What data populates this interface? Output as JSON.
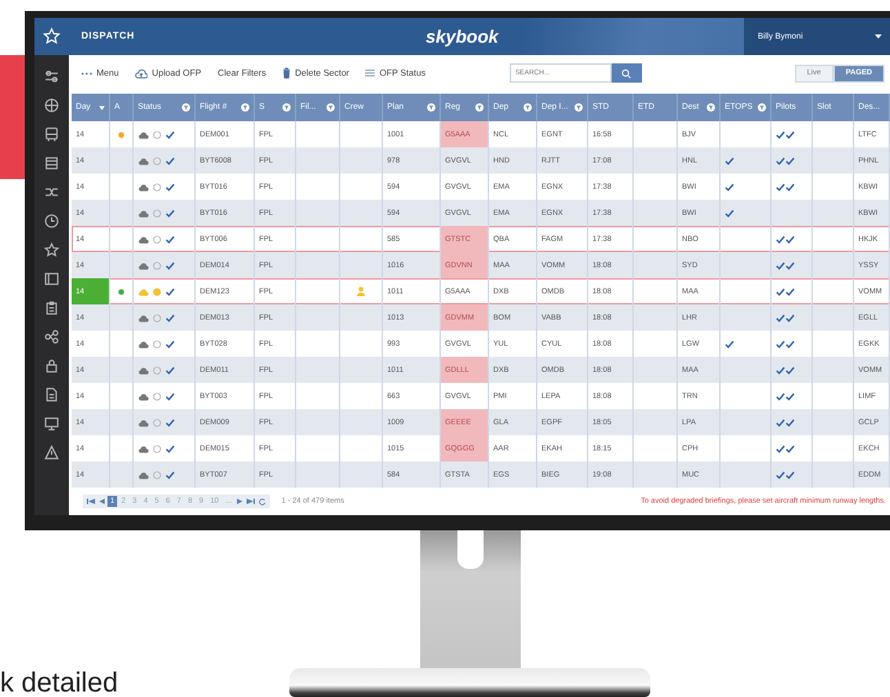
{
  "header": {
    "title": "DISPATCH",
    "brand": "skybook",
    "user": "Billy Bymoni"
  },
  "toolbar": {
    "items": [
      {
        "label": "Menu"
      },
      {
        "label": "Upload OFP"
      },
      {
        "label": "Clear Filters"
      },
      {
        "label": "Delete Sector"
      },
      {
        "label": "OFP Status"
      }
    ],
    "search": {
      "placeholder": "SEARCH..."
    },
    "view_toggle": [
      {
        "label": "Live",
        "selected": false
      },
      {
        "label": "PAGED",
        "selected": true
      }
    ]
  },
  "table": {
    "columns": [
      {
        "label": "Day",
        "kind": "sort"
      },
      {
        "label": "A",
        "kind": "plain"
      },
      {
        "label": "Status",
        "kind": "filter"
      },
      {
        "label": "Flight #",
        "kind": "filter"
      },
      {
        "label": "S",
        "kind": "filter"
      },
      {
        "label": "Fil...",
        "kind": "filter"
      },
      {
        "label": "Crew",
        "kind": "plain"
      },
      {
        "label": "Plan",
        "kind": "filter"
      },
      {
        "label": "Reg",
        "kind": "filter"
      },
      {
        "label": "Dep",
        "kind": "filter"
      },
      {
        "label": "Dep I...",
        "kind": "filter"
      },
      {
        "label": "STD",
        "kind": "plain"
      },
      {
        "label": "ETD",
        "kind": "plain"
      },
      {
        "label": "Dest",
        "kind": "filter"
      },
      {
        "label": "ETOPS",
        "kind": "filter"
      },
      {
        "label": "Pilots",
        "kind": "plain"
      },
      {
        "label": "Slot",
        "kind": "plain"
      },
      {
        "label": "Des...",
        "kind": "plain"
      }
    ],
    "rows": [
      {
        "day": "14",
        "day_highlight": false,
        "color": "#f5a623",
        "status_warning": false,
        "flight": "DEM001",
        "s": "FPL",
        "crew_alert": false,
        "plan": "1001",
        "reg": "G5AAA",
        "reg_alert": true,
        "dep": "NCL",
        "dep_icao": "EGNT",
        "std": "16:58",
        "dest": "BJV",
        "etops": false,
        "pilots": true,
        "dest_icao": "LTFC",
        "flagged": false
      },
      {
        "day": "14",
        "day_highlight": false,
        "status_warning": false,
        "flight": "BYT6008",
        "s": "FPL",
        "crew_alert": false,
        "plan": "978",
        "reg": "GVGVL",
        "reg_alert": false,
        "dep": "HND",
        "dep_icao": "RJTT",
        "std": "17:08",
        "dest": "HNL",
        "etops": true,
        "pilots": true,
        "dest_icao": "PHNL",
        "flagged": false
      },
      {
        "day": "14",
        "day_highlight": false,
        "status_warning": false,
        "flight": "BYT016",
        "s": "FPL",
        "crew_alert": false,
        "plan": "594",
        "reg": "GVGVL",
        "reg_alert": false,
        "dep": "EMA",
        "dep_icao": "EGNX",
        "std": "17:38",
        "dest": "BWI",
        "etops": true,
        "pilots": true,
        "dest_icao": "KBWI",
        "flagged": false
      },
      {
        "day": "14",
        "day_highlight": false,
        "status_warning": false,
        "flight": "BYT016",
        "s": "FPL",
        "crew_alert": false,
        "plan": "594",
        "reg": "GVGVL",
        "reg_alert": false,
        "dep": "EMA",
        "dep_icao": "EGNX",
        "std": "17:38",
        "dest": "BWI",
        "etops": true,
        "pilots": false,
        "dest_icao": "KBWI",
        "flagged": false
      },
      {
        "day": "14",
        "day_highlight": false,
        "status_warning": false,
        "flight": "BYT006",
        "s": "FPL",
        "crew_alert": false,
        "plan": "585",
        "reg": "GTSTC",
        "reg_alert": true,
        "dep": "QBA",
        "dep_icao": "FAGM",
        "std": "17:38",
        "dest": "NBO",
        "etops": false,
        "pilots": true,
        "dest_icao": "HKJK",
        "flagged": true
      },
      {
        "day": "14",
        "day_highlight": false,
        "status_warning": false,
        "flight": "DEM014",
        "s": "FPL",
        "crew_alert": false,
        "plan": "1016",
        "reg": "GDVNN",
        "reg_alert": true,
        "dep": "MAA",
        "dep_icao": "VOMM",
        "std": "18:08",
        "dest": "SYD",
        "etops": false,
        "pilots": true,
        "dest_icao": "YSSY",
        "flagged": false
      },
      {
        "day": "14",
        "day_highlight": true,
        "color": "#3cb043",
        "status_warning": true,
        "flight": "DEM123",
        "s": "FPL",
        "crew_alert": true,
        "plan": "1011",
        "reg": "G5AAA",
        "reg_alert": false,
        "dep": "DXB",
        "dep_icao": "OMDB",
        "std": "18:08",
        "dest": "MAA",
        "etops": false,
        "pilots": true,
        "dest_icao": "VOMM",
        "flagged": true
      },
      {
        "day": "14",
        "day_highlight": false,
        "status_warning": false,
        "flight": "DEM013",
        "s": "FPL",
        "crew_alert": false,
        "plan": "1013",
        "reg": "GDVMM",
        "reg_alert": true,
        "dep": "BOM",
        "dep_icao": "VABB",
        "std": "18:08",
        "dest": "LHR",
        "etops": false,
        "pilots": true,
        "dest_icao": "EGLL",
        "flagged": false
      },
      {
        "day": "14",
        "day_highlight": false,
        "status_warning": false,
        "flight": "BYT028",
        "s": "FPL",
        "crew_alert": false,
        "plan": "993",
        "reg": "GVGVL",
        "reg_alert": false,
        "dep": "YUL",
        "dep_icao": "CYUL",
        "std": "18:08",
        "dest": "LGW",
        "etops": true,
        "pilots": true,
        "dest_icao": "EGKK",
        "flagged": false
      },
      {
        "day": "14",
        "day_highlight": false,
        "status_warning": false,
        "flight": "DEM011",
        "s": "FPL",
        "crew_alert": false,
        "plan": "1011",
        "reg": "GDLLL",
        "reg_alert": true,
        "dep": "DXB",
        "dep_icao": "OMDB",
        "std": "18:08",
        "dest": "MAA",
        "etops": false,
        "pilots": true,
        "dest_icao": "VOMM",
        "flagged": false
      },
      {
        "day": "14",
        "day_highlight": false,
        "status_warning": false,
        "flight": "BYT003",
        "s": "FPL",
        "crew_alert": false,
        "plan": "663",
        "reg": "GVGVL",
        "reg_alert": false,
        "dep": "PMI",
        "dep_icao": "LEPA",
        "std": "18:08",
        "dest": "TRN",
        "etops": false,
        "pilots": true,
        "dest_icao": "LIMF",
        "flagged": false
      },
      {
        "day": "14",
        "day_highlight": false,
        "status_warning": false,
        "flight": "DEM009",
        "s": "FPL",
        "crew_alert": false,
        "plan": "1009",
        "reg": "GEEEE",
        "reg_alert": true,
        "dep": "GLA",
        "dep_icao": "EGPF",
        "std": "18:05",
        "dest": "LPA",
        "etops": false,
        "pilots": true,
        "dest_icao": "GCLP",
        "flagged": false
      },
      {
        "day": "14",
        "day_highlight": false,
        "status_warning": false,
        "flight": "DEM015",
        "s": "FPL",
        "crew_alert": false,
        "plan": "1015",
        "reg": "GQGGG",
        "reg_alert": true,
        "dep": "AAR",
        "dep_icao": "EKAH",
        "std": "18:15",
        "dest": "CPH",
        "etops": false,
        "pilots": true,
        "dest_icao": "EKCH",
        "flagged": false
      },
      {
        "day": "14",
        "day_highlight": false,
        "status_warning": false,
        "flight": "BYT007",
        "s": "FPL",
        "crew_alert": false,
        "plan": "584",
        "reg": "GTSTA",
        "reg_alert": false,
        "dep": "EGS",
        "dep_icao": "BIEG",
        "std": "19:08",
        "dest": "MUC",
        "etops": false,
        "pilots": true,
        "dest_icao": "EDDM",
        "flagged": false
      }
    ]
  },
  "pager": {
    "pages": [
      {
        "label": "1",
        "selected": true
      },
      {
        "label": "2",
        "selected": false
      },
      {
        "label": "3",
        "selected": false
      },
      {
        "label": "4",
        "selected": false
      },
      {
        "label": "5",
        "selected": false
      },
      {
        "label": "6",
        "selected": false
      },
      {
        "label": "7",
        "selected": false
      },
      {
        "label": "8",
        "selected": false
      },
      {
        "label": "9",
        "selected": false
      },
      {
        "label": "10",
        "selected": false
      },
      {
        "label": "...",
        "selected": false
      }
    ],
    "summary": "1 - 24 of 479 items"
  },
  "notice": "To avoid degraded briefings, please set aircraft minimum runway lengths.",
  "caption": "k detailed"
}
